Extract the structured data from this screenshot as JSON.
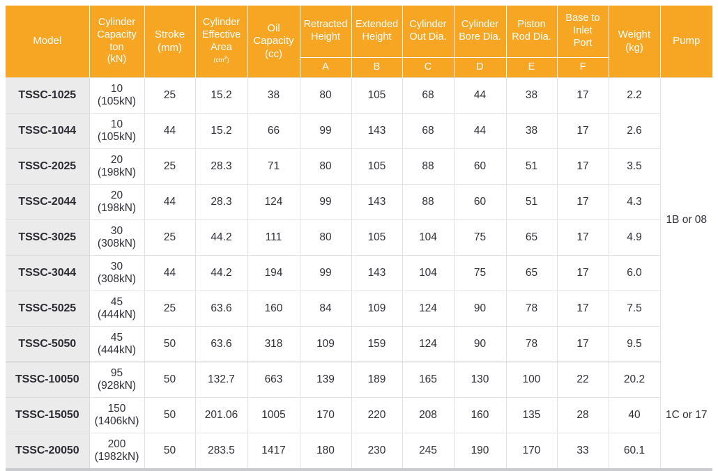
{
  "table": {
    "columns": [
      {
        "key": "model",
        "label": "Model",
        "sub": ""
      },
      {
        "key": "cap",
        "label": "Cylinder Capacity ton (kN)",
        "sub": ""
      },
      {
        "key": "stroke",
        "label": "Stroke (mm)",
        "sub": ""
      },
      {
        "key": "area",
        "label": "Cylinder Effective Area (cm2)",
        "sub": ""
      },
      {
        "key": "oil",
        "label": "Oil Capacity (cc)",
        "sub": ""
      },
      {
        "key": "a",
        "label": "Retracted Height",
        "sub": "A"
      },
      {
        "key": "b",
        "label": "Extended Height",
        "sub": "B"
      },
      {
        "key": "c",
        "label": "Cylinder Out Dia.",
        "sub": "C"
      },
      {
        "key": "d",
        "label": "Cylinder Bore Dia.",
        "sub": "D"
      },
      {
        "key": "e",
        "label": "Piston Rod Dia.",
        "sub": "E"
      },
      {
        "key": "f",
        "label": "Base to Inlet Port",
        "sub": "F"
      },
      {
        "key": "weight",
        "label": "Weight (kg)",
        "sub": ""
      },
      {
        "key": "pump",
        "label": "Pump",
        "sub": ""
      }
    ],
    "header": {
      "model": "Model",
      "cap_l1": "Cylinder",
      "cap_l2": "Capacity",
      "cap_l3": "ton",
      "cap_l4": "(kN)",
      "stroke_l1": "Stroke",
      "stroke_l2": "(mm)",
      "area_l1": "Cylinder",
      "area_l2": "Effective",
      "area_l3": "Area",
      "area_l4": "(cm",
      "area_sup": "2",
      "area_l5": ")",
      "oil_l1": "Oil",
      "oil_l2": "Capacity",
      "oil_l3": "(cc)",
      "a_l1": "Retracted",
      "a_l2": "Height",
      "b_l1": "Extended",
      "b_l2": "Height",
      "c_l1": "Cylinder",
      "c_l2": "Out Dia.",
      "d_l1": "Cylinder",
      "d_l2": "Bore Dia.",
      "e_l1": "Piston",
      "e_l2": "Rod Dia.",
      "f_l1": "Base to",
      "f_l2": "Inlet",
      "f_l3": "Port",
      "weight_l1": "Weight",
      "weight_l2": "(kg)",
      "pump": "Pump",
      "sub_a": "A",
      "sub_b": "B",
      "sub_c": "C",
      "sub_d": "D",
      "sub_e": "E",
      "sub_f": "F"
    },
    "rows": [
      {
        "model": "TSSC-1025",
        "cap_ton": "10",
        "cap_kn": "(105kN)",
        "stroke": "25",
        "area": "15.2",
        "oil": "38",
        "a": "80",
        "b": "105",
        "c": "68",
        "d": "44",
        "e": "38",
        "f": "17",
        "weight": "2.2"
      },
      {
        "model": "TSSC-1044",
        "cap_ton": "10",
        "cap_kn": "(105kN)",
        "stroke": "44",
        "area": "15.2",
        "oil": "66",
        "a": "99",
        "b": "143",
        "c": "68",
        "d": "44",
        "e": "38",
        "f": "17",
        "weight": "2.6"
      },
      {
        "model": "TSSC-2025",
        "cap_ton": "20",
        "cap_kn": "(198kN)",
        "stroke": "25",
        "area": "28.3",
        "oil": "71",
        "a": "80",
        "b": "105",
        "c": "88",
        "d": "60",
        "e": "51",
        "f": "17",
        "weight": "3.5"
      },
      {
        "model": "TSSC-2044",
        "cap_ton": "20",
        "cap_kn": "(198kN)",
        "stroke": "44",
        "area": "28.3",
        "oil": "124",
        "a": "99",
        "b": "143",
        "c": "88",
        "d": "60",
        "e": "51",
        "f": "17",
        "weight": "4.3"
      },
      {
        "model": "TSSC-3025",
        "cap_ton": "30",
        "cap_kn": "(308kN)",
        "stroke": "25",
        "area": "44.2",
        "oil": "111",
        "a": "80",
        "b": "105",
        "c": "104",
        "d": "75",
        "e": "65",
        "f": "17",
        "weight": "4.9"
      },
      {
        "model": "TSSC-3044",
        "cap_ton": "30",
        "cap_kn": "(308kN)",
        "stroke": "44",
        "area": "44.2",
        "oil": "194",
        "a": "99",
        "b": "143",
        "c": "104",
        "d": "75",
        "e": "65",
        "f": "17",
        "weight": "6.0"
      },
      {
        "model": "TSSC-5025",
        "cap_ton": "45",
        "cap_kn": "(444kN)",
        "stroke": "25",
        "area": "63.6",
        "oil": "160",
        "a": "84",
        "b": "109",
        "c": "124",
        "d": "90",
        "e": "78",
        "f": "17",
        "weight": "7.5"
      },
      {
        "model": "TSSC-5050",
        "cap_ton": "45",
        "cap_kn": "(444kN)",
        "stroke": "50",
        "area": "63.6",
        "oil": "318",
        "a": "109",
        "b": "159",
        "c": "124",
        "d": "90",
        "e": "78",
        "f": "17",
        "weight": "9.5"
      },
      {
        "model": "TSSC-10050",
        "cap_ton": "95",
        "cap_kn": "(928kN)",
        "stroke": "50",
        "area": "132.7",
        "oil": "663",
        "a": "139",
        "b": "189",
        "c": "165",
        "d": "130",
        "e": "100",
        "f": "22",
        "weight": "20.2"
      },
      {
        "model": "TSSC-15050",
        "cap_ton": "150",
        "cap_kn": "(1406kN)",
        "stroke": "50",
        "area": "201.06",
        "oil": "1005",
        "a": "170",
        "b": "220",
        "c": "208",
        "d": "160",
        "e": "135",
        "f": "28",
        "weight": "40"
      },
      {
        "model": "TSSC-20050",
        "cap_ton": "200",
        "cap_kn": "(1982kN)",
        "stroke": "50",
        "area": "283.5",
        "oil": "1417",
        "a": "180",
        "b": "230",
        "c": "245",
        "d": "190",
        "e": "170",
        "f": "33",
        "weight": "60.1"
      }
    ],
    "pump_groups": [
      {
        "label": "1B or 08",
        "rows": 8
      },
      {
        "label": "1C or 17",
        "rows": 3
      }
    ],
    "colors": {
      "header_bg": "#f6a623",
      "header_text": "#ffffff",
      "model_bg": "#ebebeb",
      "cell_text": "#2f2f38",
      "grid": "#e2e2e2",
      "bottom_bar": "#c9cbcf"
    }
  }
}
